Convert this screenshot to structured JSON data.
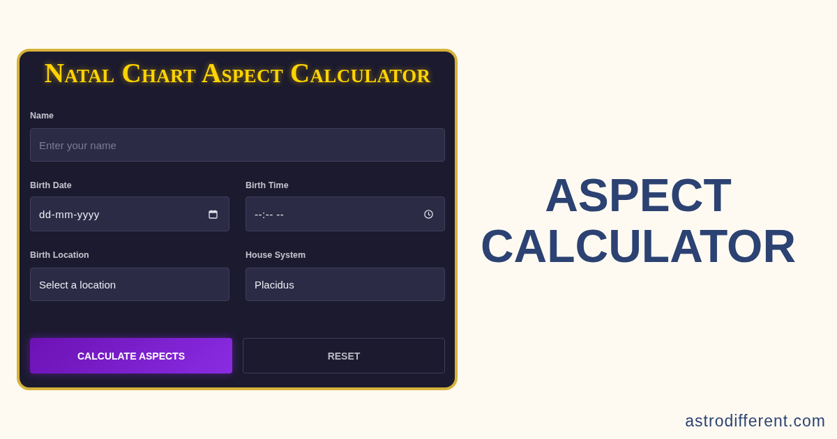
{
  "form_card": {
    "title": "Natal Chart Aspect Calculator",
    "fields": [
      {
        "kind": "text",
        "label": "Name",
        "placeholder": "Enter your name"
      },
      {
        "kind": "date",
        "label": "Birth Date",
        "placeholder": "dd-mm-yyyy"
      },
      {
        "kind": "time",
        "label": "Birth Time",
        "placeholder": "--:-- --"
      },
      {
        "kind": "select",
        "label": "Birth Location",
        "value": "Select a location"
      },
      {
        "kind": "select",
        "label": "House System",
        "value": "Placidus"
      }
    ],
    "buttons": [
      {
        "kind": "primary",
        "label": "CALCULATE ASPECTS"
      },
      {
        "kind": "secondary",
        "label": "RESET"
      }
    ]
  },
  "headline": "ASPECT CALCULATOR",
  "website": "astrodifferent.com"
}
